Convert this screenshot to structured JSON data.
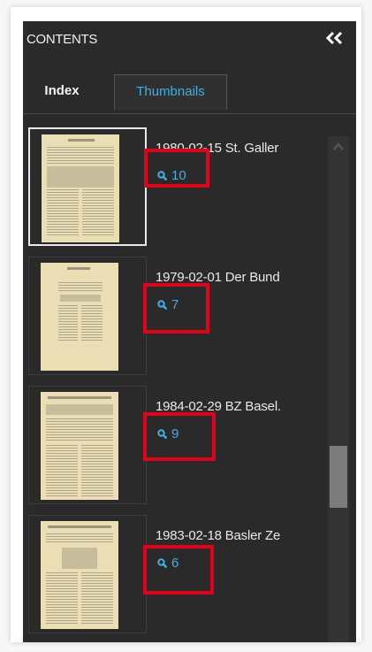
{
  "panel": {
    "title": "CONTENTS",
    "collapse_icon": "double-chevron-left-icon"
  },
  "tabs": [
    {
      "label": "Index",
      "active": false
    },
    {
      "label": "Thumbnails",
      "active": true
    }
  ],
  "items": [
    {
      "title": "1980-02-15 St. Galler",
      "hits": "10",
      "selected": true
    },
    {
      "title": "1979-02-01 Der Bund",
      "hits": "7",
      "selected": false
    },
    {
      "title": "1984-02-29 BZ Basel.",
      "hits": "9",
      "selected": false
    },
    {
      "title": "1983-02-18 Basler Ze",
      "hits": "6",
      "selected": false
    }
  ],
  "colors": {
    "panel_bg": "#2a2a2a",
    "accent": "#3fb0e2",
    "highlight": "#e2001a",
    "page": "#eadfb4"
  }
}
